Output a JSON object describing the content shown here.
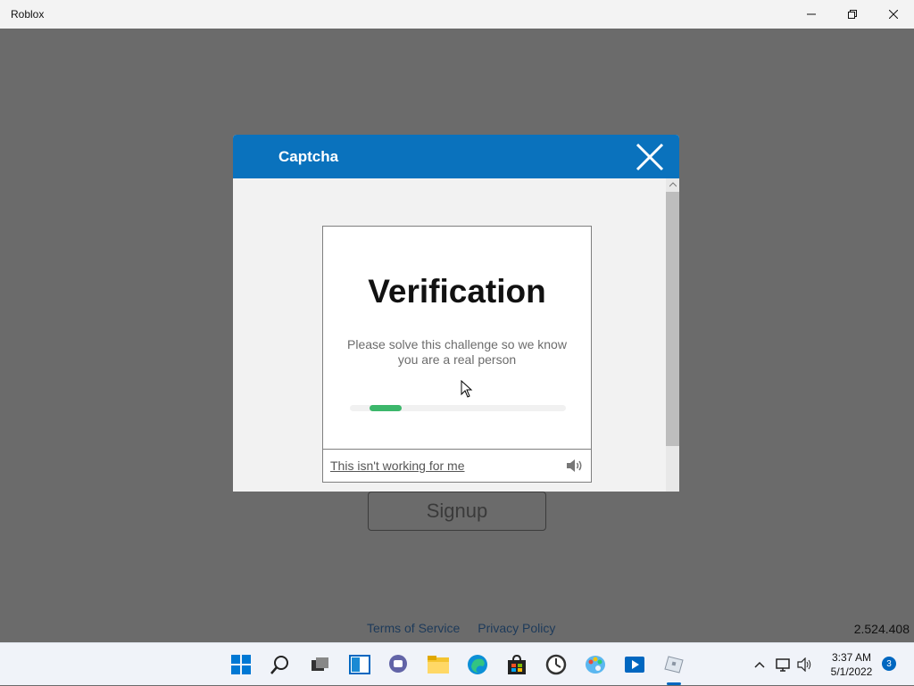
{
  "window": {
    "title": "Roblox"
  },
  "app": {
    "signup_label": "Signup",
    "footer": {
      "terms": "Terms of Service",
      "privacy": "Privacy Policy"
    },
    "version": "2.524.408"
  },
  "captcha": {
    "title": "Captcha",
    "heading": "Verification",
    "description": "Please solve this challenge so we know you are a real person",
    "help_link": "This isn't working for me",
    "progress": 0.15,
    "colors": {
      "header": "#0a72bd",
      "progress": "#3cb76b"
    }
  },
  "taskbar": {
    "icons": [
      "windows-start-icon",
      "search-icon",
      "task-view-icon",
      "widgets-icon",
      "teams-chat-icon",
      "file-explorer-icon",
      "edge-icon",
      "store-icon",
      "clock-app-icon",
      "paint-icon",
      "media-player-icon",
      "roblox-icon"
    ],
    "time": "3:37 AM",
    "date": "5/1/2022",
    "notification_count": "3"
  }
}
